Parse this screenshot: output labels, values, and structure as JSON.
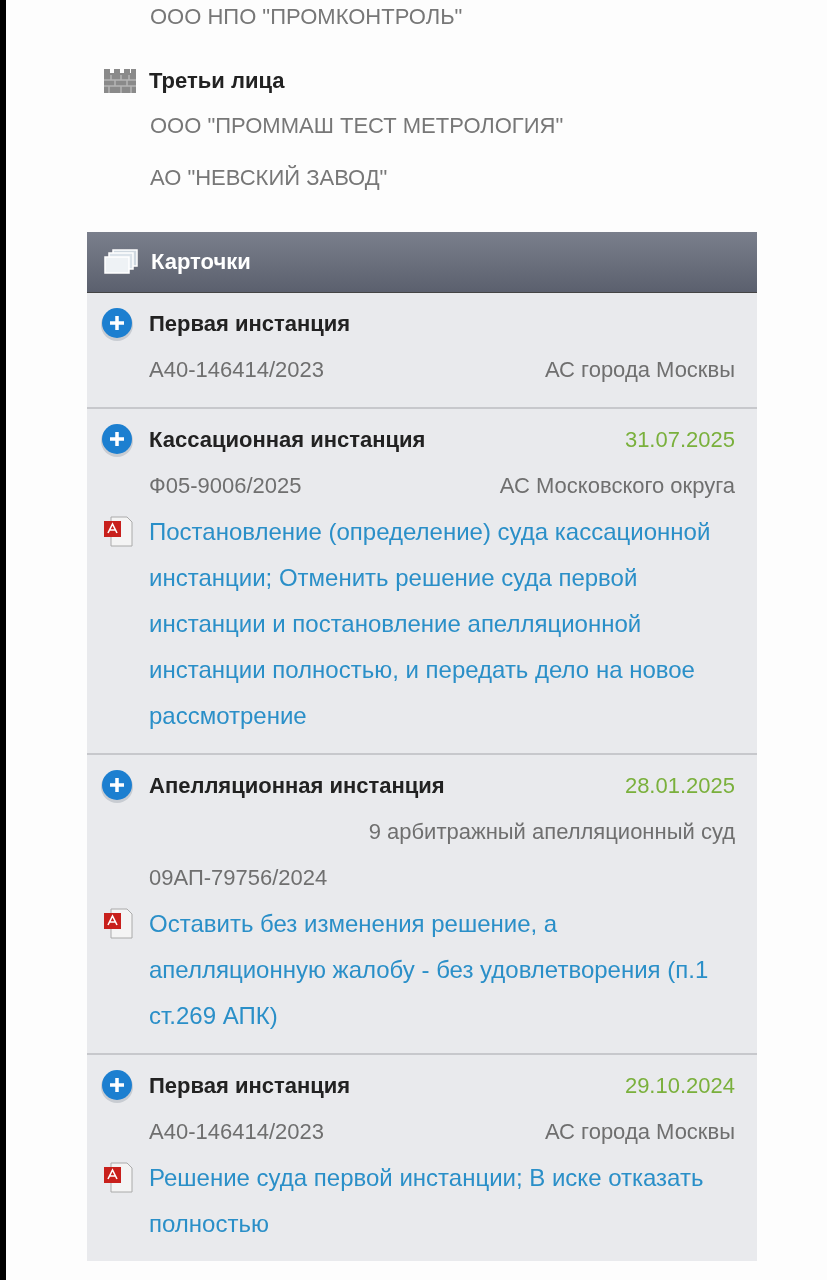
{
  "previous_party": "ООО НПО \"ПРОМКОНТРОЛЬ\"",
  "third_parties": {
    "title": "Третьи лица",
    "items": [
      "ООО \"ПРОММАШ ТЕСТ МЕТРОЛОГИЯ\"",
      "АО \"НЕВСКИЙ ЗАВОД\""
    ]
  },
  "cards": {
    "title": "Карточки",
    "items": [
      {
        "kind": "inline",
        "title": "Первая инстанция",
        "number": "А40-146414/2023",
        "court": "АС города Москвы"
      },
      {
        "kind": "inline",
        "title": "Кассационная инстанция",
        "date": "31.07.2025",
        "number": "Ф05-9006/2025",
        "court": "АС Московского округа",
        "documents": [
          "Постановление (определение) суда кассационной инстанции; Отменить решение суда первой инстанции и постановление апелляционной инстанции полностью, и передать дело на новое рассмотрение"
        ]
      },
      {
        "kind": "stacked",
        "title": "Апелляционная инстанция",
        "date": "28.01.2025",
        "number": "09АП-79756/2024",
        "court": "9 арбитражный апелляционный суд",
        "documents": [
          "Оставить без изменения решение, а апелляционную жалобу - без удовлетворения (п.1 ст.269 АПК)"
        ]
      },
      {
        "kind": "inline",
        "title": "Первая инстанция",
        "date": "29.10.2024",
        "number": "А40-146414/2023",
        "court": "АС города Москвы",
        "documents": [
          "Решение суда первой инстанции; В иске отказать полностью"
        ]
      }
    ]
  }
}
